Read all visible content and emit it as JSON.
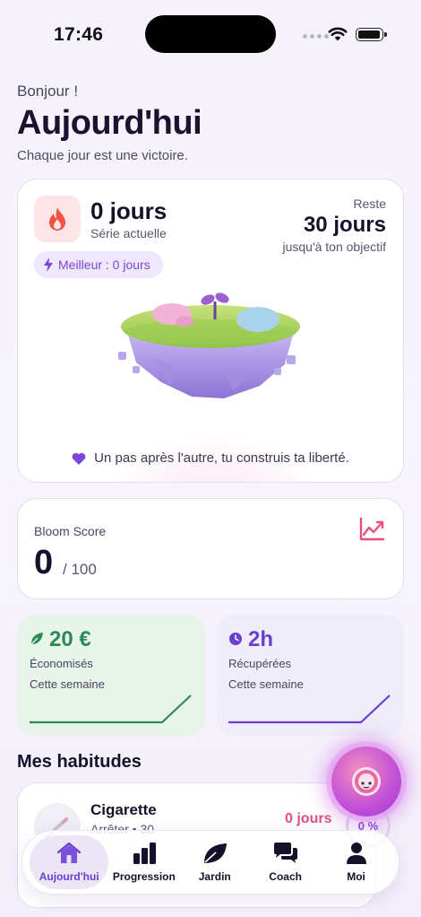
{
  "status_bar": {
    "time": "17:46"
  },
  "header": {
    "greeting": "Bonjour !",
    "title": "Aujourd'hui",
    "subtitle": "Chaque jour est une victoire."
  },
  "streak": {
    "count": "0 jours",
    "label": "Série actuelle",
    "remaining_label": "Reste",
    "remaining_days": "30 jours",
    "remaining_sub": "jusqu'à ton objectif",
    "best": "Meilleur : 0 jours",
    "quote": "Un pas après l'autre, tu construis ta liberté."
  },
  "score": {
    "label": "Bloom Score",
    "value": "0",
    "max": "/ 100"
  },
  "stats": {
    "money": {
      "value": "20 €",
      "label": "Économisés",
      "period": "Cette semaine",
      "color": "#2c8a57"
    },
    "time": {
      "value": "2h",
      "label": "Récupérées",
      "period": "Cette semaine",
      "color": "#6a3fd0"
    }
  },
  "habits": {
    "title": "Mes habitudes",
    "items": [
      {
        "name": "Cigarette",
        "sub": "Arrêter • 30",
        "days": "0 jours",
        "percent": "0 %"
      }
    ]
  },
  "tabs": [
    {
      "label": "Aujourd'hui",
      "icon": "home-icon",
      "active": true
    },
    {
      "label": "Progression",
      "icon": "bar-chart-icon",
      "active": false
    },
    {
      "label": "Jardin",
      "icon": "leaf-icon",
      "active": false
    },
    {
      "label": "Coach",
      "icon": "chat-bubbles-icon",
      "active": false
    },
    {
      "label": "Moi",
      "icon": "person-icon",
      "active": false
    }
  ],
  "colors": {
    "accent": "#6a3fd0",
    "streak_flame": "#f0533f",
    "trend": "#e2517b"
  }
}
